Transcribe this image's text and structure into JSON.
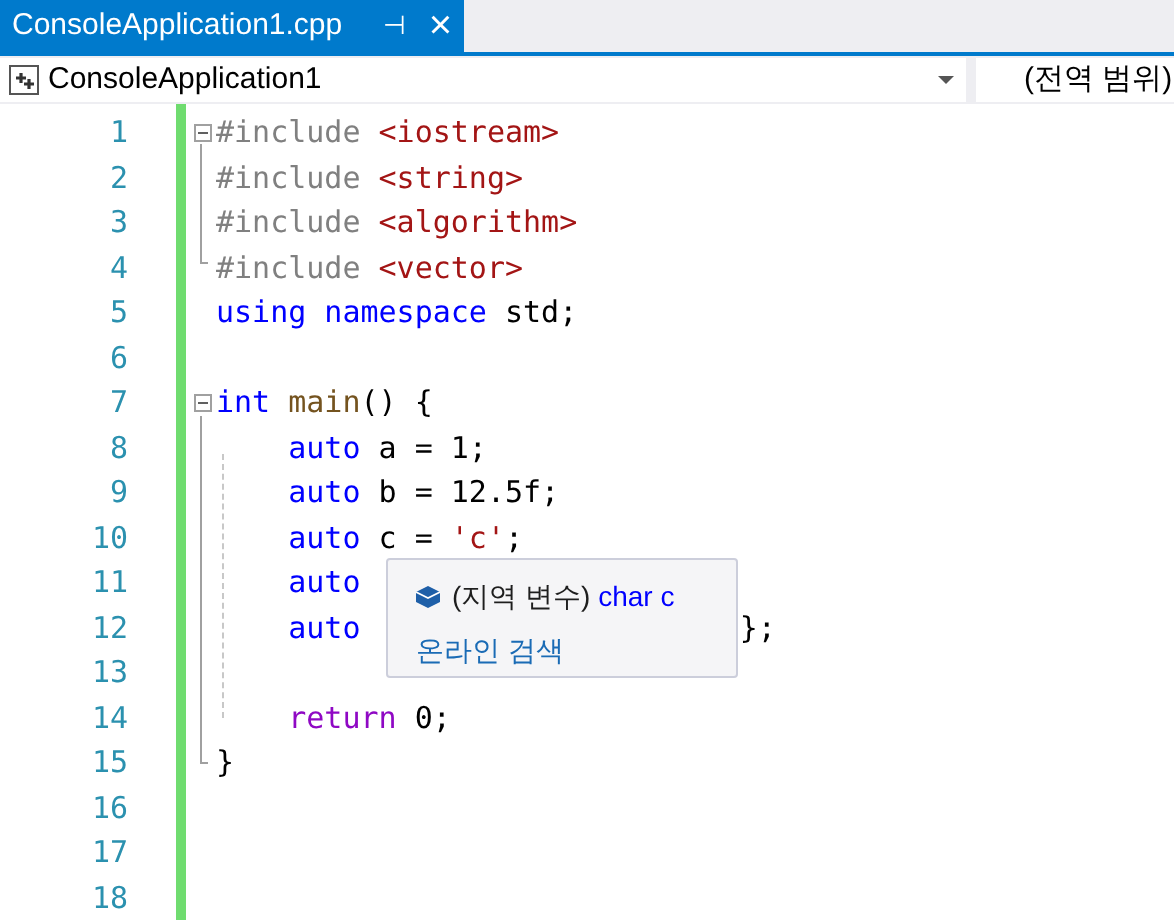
{
  "tab": {
    "title": "ConsoleApplication1.cpp",
    "pin": "⊣",
    "close": "×",
    "selected": true
  },
  "nav": {
    "project": "ConsoleApplication1",
    "scope": "(전역 범위)"
  },
  "lines": [
    {
      "number": "1",
      "outline": {
        "expanded": true
      },
      "tokens": [
        {
          "text": "#include ",
          "kind": "preprocessor"
        },
        {
          "text": "<iostream>",
          "kind": "string"
        }
      ]
    },
    {
      "number": "2",
      "tokens": [
        {
          "text": "#include ",
          "kind": "preprocessor"
        },
        {
          "text": "<string>",
          "kind": "string"
        }
      ]
    },
    {
      "number": "3",
      "tokens": [
        {
          "text": "#include ",
          "kind": "preprocessor"
        },
        {
          "text": "<algorithm>",
          "kind": "string"
        }
      ]
    },
    {
      "number": "4",
      "tokens": [
        {
          "text": "#include ",
          "kind": "preprocessor"
        },
        {
          "text": "<vector>",
          "kind": "string"
        }
      ]
    },
    {
      "number": "5",
      "tokens": [
        {
          "text": "using namespace ",
          "kind": "keyword"
        },
        {
          "text": "std;",
          "kind": "plain"
        }
      ]
    },
    {
      "number": "6"
    },
    {
      "number": "7",
      "outline": {
        "expanded": true
      },
      "tokens": [
        {
          "text": "int ",
          "kind": "keyword"
        },
        {
          "text": "main",
          "kind": "function"
        },
        {
          "text": "() {",
          "kind": "plain"
        }
      ]
    },
    {
      "number": "8",
      "tokens": [
        {
          "text": "    auto ",
          "kind": "keyword"
        },
        {
          "text": "a = 1;",
          "kind": "plain"
        }
      ]
    },
    {
      "number": "9",
      "tokens": [
        {
          "text": "    auto ",
          "kind": "keyword"
        },
        {
          "text": "b = 12.5f;",
          "kind": "plain"
        }
      ]
    },
    {
      "number": "10",
      "tokens": [
        {
          "text": "    auto ",
          "kind": "keyword"
        },
        {
          "text": "c = ",
          "kind": "plain"
        },
        {
          "text": "'c'",
          "kind": "string"
        },
        {
          "text": ";",
          "kind": "plain"
        }
      ]
    },
    {
      "number": "11",
      "tokens": [
        {
          "text": "    auto",
          "kind": "keyword"
        }
      ]
    },
    {
      "number": "12",
      "tokens": [
        {
          "text": "    auto",
          "kind": "keyword"
        },
        {
          "text": "                     };",
          "kind": "plain"
        }
      ]
    },
    {
      "number": "13"
    },
    {
      "number": "14",
      "tokens": [
        {
          "text": "    return ",
          "kind": "control"
        },
        {
          "text": "0;",
          "kind": "plain"
        }
      ]
    },
    {
      "number": "15",
      "tokens": [
        {
          "text": "}",
          "kind": "plain"
        }
      ]
    },
    {
      "number": "16"
    },
    {
      "number": "17"
    },
    {
      "number": "18"
    }
  ],
  "tooltip": {
    "kind_label": "(지역 변수)",
    "type_text": "char c",
    "link": "온라인 검색"
  }
}
